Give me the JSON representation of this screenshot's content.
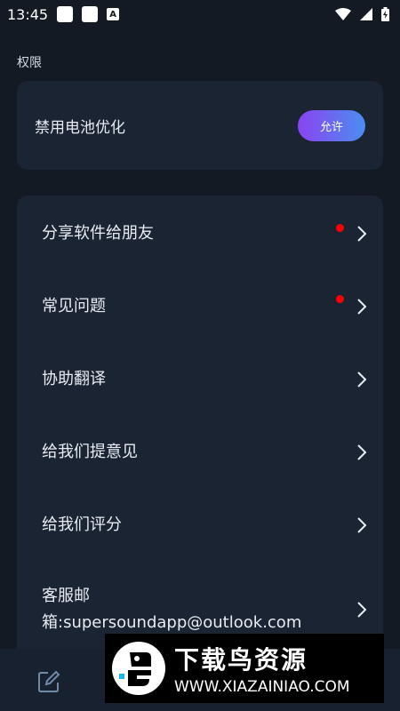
{
  "status_bar": {
    "time": "13:45",
    "badge": "A"
  },
  "section_title": "权限",
  "battery": {
    "label": "禁用电池优化",
    "button": "允许"
  },
  "menu": [
    {
      "label": "分享软件给朋友",
      "badge": true
    },
    {
      "label": "常见问题",
      "badge": true
    },
    {
      "label": "协助翻译",
      "badge": false
    },
    {
      "label": "给我们提意见",
      "badge": false
    },
    {
      "label": "给我们评分",
      "badge": false
    },
    {
      "label": "客服邮箱:supersoundapp@outlook.com",
      "badge": false
    }
  ],
  "watermark": {
    "title": "下载鸟资源",
    "url": "WWW.XIAZAINIAO.COM"
  },
  "colors": {
    "background": "#141a24",
    "card": "#1b2432",
    "badge": "#ff0000",
    "gradient_start": "#8a43f1",
    "gradient_end": "#4b8ef0"
  }
}
